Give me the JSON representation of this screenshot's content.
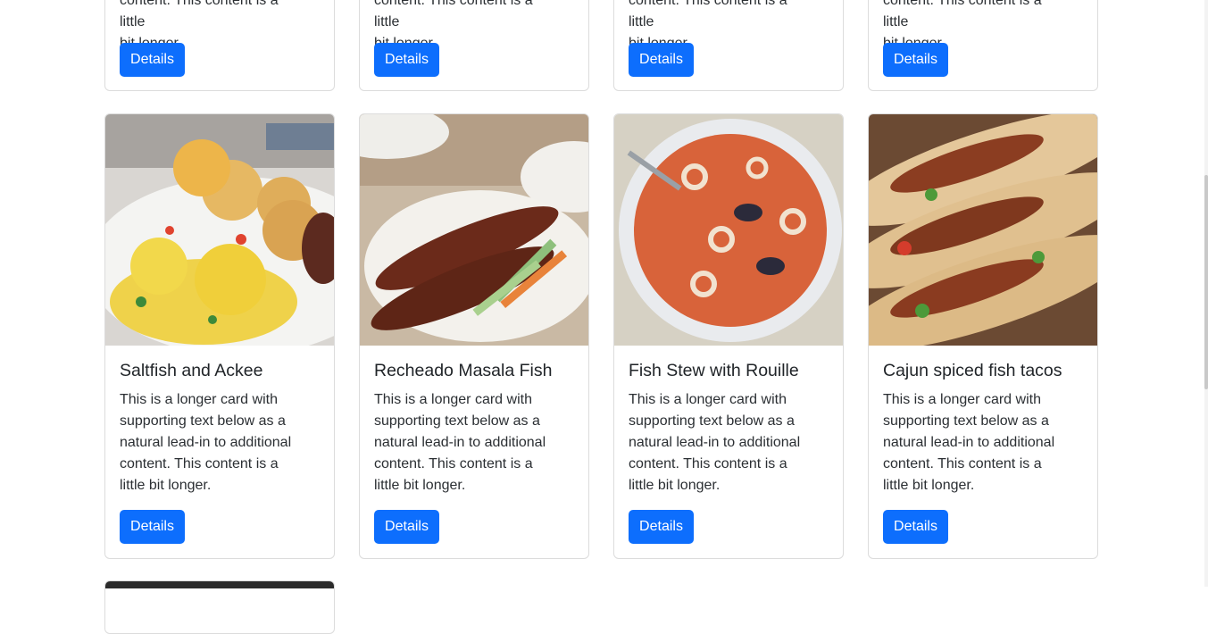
{
  "button_label": "Details",
  "top_row": {
    "line1": "content. This content is a little",
    "line2": "bit longer."
  },
  "cards": [
    {
      "title": "Saltfish and Ackee",
      "text": "This is a longer card with supporting text below as a natural lead-in to additional content. This content is a little bit longer.",
      "button": "Details",
      "image": "saltfish-and-ackee-photo"
    },
    {
      "title": "Recheado Masala Fish",
      "text": "This is a longer card with supporting text below as a natural lead-in to additional content. This content is a little bit longer.",
      "button": "Details",
      "image": "recheado-masala-fish-photo"
    },
    {
      "title": "Fish Stew with Rouille",
      "text": "This is a longer card with supporting text below as a natural lead-in to additional content. This content is a little bit longer.",
      "button": "Details",
      "image": "fish-stew-photo"
    },
    {
      "title": "Cajun spiced fish tacos",
      "text": "This is a longer card with supporting text below as a natural lead-in to additional content. This content is a little bit longer.",
      "button": "Details",
      "image": "fish-tacos-photo"
    }
  ],
  "colors": {
    "button": "#0d6efd",
    "border": "#dcdcdc"
  }
}
